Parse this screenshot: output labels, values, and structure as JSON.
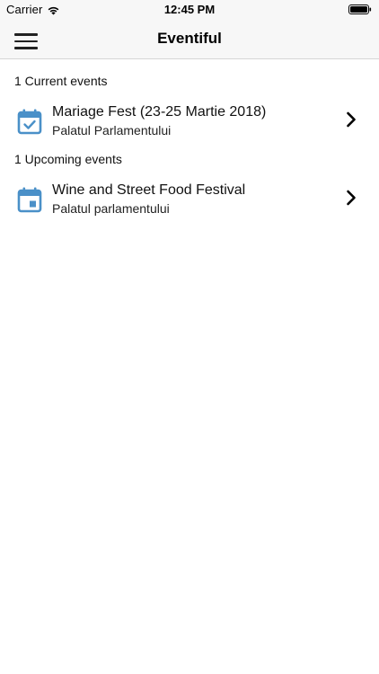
{
  "status_bar": {
    "carrier": "Carrier",
    "time": "12:45 PM"
  },
  "nav_bar": {
    "title": "Eventiful",
    "menu_icon": "hamburger-menu-icon"
  },
  "sections": [
    {
      "header": "1 Current events",
      "events": [
        {
          "title": "Mariage Fest (23-25 Martie 2018)",
          "location": "Palatul Parlamentului",
          "icon": "calendar-check-icon"
        }
      ]
    },
    {
      "header": "1 Upcoming events",
      "events": [
        {
          "title": "Wine and Street Food Festival",
          "location": "Palatul parlamentului",
          "icon": "calendar-today-icon"
        }
      ]
    }
  ],
  "colors": {
    "accent": "#4a90c8",
    "bar_background": "#f7f7f7"
  }
}
